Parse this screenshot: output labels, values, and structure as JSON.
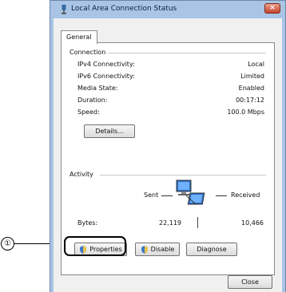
{
  "window": {
    "title": "Local Area Connection Status",
    "close_label": "×"
  },
  "tabs": [
    {
      "label": "General"
    }
  ],
  "connection": {
    "title": "Connection",
    "rows": [
      {
        "label": "IPv4 Connectivity:",
        "value": "Local"
      },
      {
        "label": "IPv6 Connectivity:",
        "value": "Limited"
      },
      {
        "label": "Media State:",
        "value": "Enabled"
      },
      {
        "label": "Duration:",
        "value": "00:17:12"
      },
      {
        "label": "Speed:",
        "value": "100.0 Mbps"
      }
    ],
    "details_button": "Details..."
  },
  "activity": {
    "title": "Activity",
    "sent_label": "Sent",
    "received_label": "Received",
    "bytes_label": "Bytes:",
    "sent_bytes": "22,119",
    "received_bytes": "10,466"
  },
  "buttons": {
    "properties": "Properties",
    "disable": "Disable",
    "diagnose": "Diagnose",
    "close": "Close"
  },
  "callout": {
    "number": "①"
  },
  "icons": {
    "title": "network-icon",
    "activity": "network-computers-icon",
    "shield": "uac-shield-icon"
  },
  "colors": {
    "frame": "#a9c4e4",
    "close_button": "#c9442c",
    "client_bg": "#f0f0f0"
  }
}
